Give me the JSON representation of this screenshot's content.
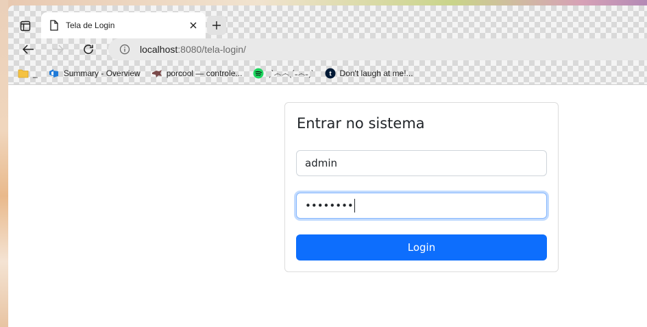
{
  "browser": {
    "tab": {
      "title": "Tela de Login"
    },
    "address_bar": {
      "host": "localhost",
      "rest": ":8080/tela-login/"
    },
    "bookmarks": [
      {
        "label": "_",
        "icon": "folder-icon"
      },
      {
        "label": "Summary - Overview",
        "icon": "azure-devops-icon"
      },
      {
        "label": "porcool — controle...",
        "icon": "pig-icon"
      },
      {
        "label": "ˏˋ෴෴ˎˊ˗෴˗ˏˋ",
        "icon": "spotify-icon"
      },
      {
        "label": "Don't laugh at me!...",
        "icon": "tumblr-icon"
      }
    ]
  },
  "login": {
    "title": "Entrar no sistema",
    "username_value": "admin",
    "password_value": "••••••••",
    "submit_label": "Login"
  },
  "colors": {
    "primary": "#0d6efd",
    "focus_border": "#86b7fe",
    "card_border": "#dcdcdc"
  }
}
